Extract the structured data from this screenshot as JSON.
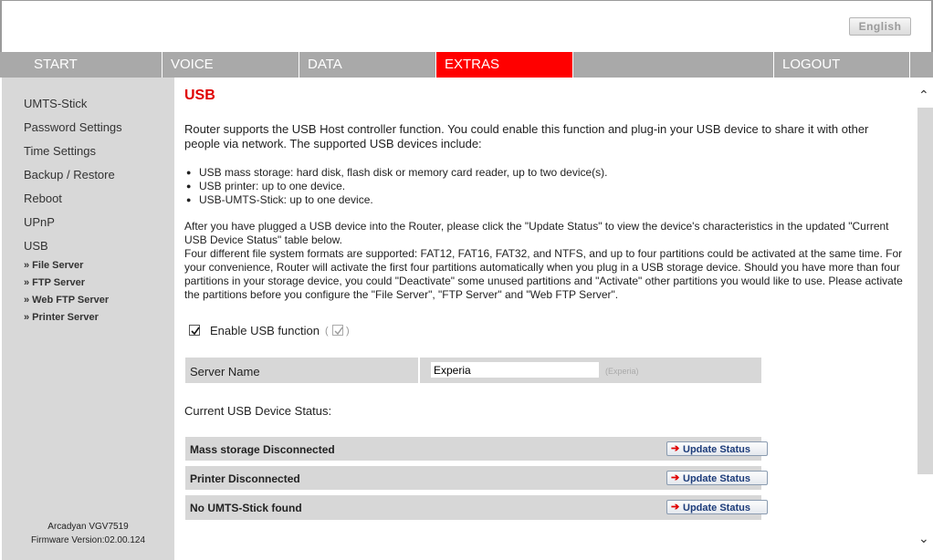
{
  "header": {
    "language_button": "English"
  },
  "nav": {
    "tabs": [
      {
        "label": "START"
      },
      {
        "label": "VOICE"
      },
      {
        "label": "DATA"
      },
      {
        "label": "EXTRAS"
      },
      {
        "label": ""
      },
      {
        "label": "LOGOUT"
      }
    ],
    "active_tab": "EXTRAS",
    "active_color": "#ff0000"
  },
  "sidebar": {
    "items": [
      {
        "label": "UMTS-Stick"
      },
      {
        "label": "Password Settings"
      },
      {
        "label": "Time Settings"
      },
      {
        "label": "Backup / Restore"
      },
      {
        "label": "Reboot"
      },
      {
        "label": "UPnP"
      },
      {
        "label": "USB"
      }
    ],
    "subitems": [
      {
        "label": "» File Server"
      },
      {
        "label": "» FTP Server"
      },
      {
        "label": "» Web FTP Server"
      },
      {
        "label": "» Printer Server"
      }
    ],
    "footer": {
      "model": "Arcadyan VGV7519",
      "firmware": "Firmware Version:02.00.124"
    }
  },
  "main": {
    "title": "USB",
    "intro": "Router supports the USB Host controller function. You could enable this function and plug-in your USB device to share it with other people via network. The supported USB devices include:",
    "bullets": [
      "USB mass storage: hard disk, flash disk or memory card reader, up to two device(s).",
      "USB printer: up to one device.",
      "USB-UMTS-Stick: up to one device."
    ],
    "details": "After you have plugged a USB device into the Router, please click the \"Update Status\" to view the device's characteristics in the updated \"Current USB Device Status\" table below.\nFour different file system formats are supported: FAT12, FAT16, FAT32, and NTFS, and up to four partitions could be activated at the same time. For your convenience, Router will activate the first four partitions automatically when you plug in a USB storage device. Should you have more than four partitions in your storage device, you could \"Deactivate\" some unused partitions and \"Activate\" other partitions you would like to use. Please activate the partitions before you configure the \"File Server\", \"FTP Server\" and \"Web FTP Server\".",
    "enable_usb": {
      "label": "Enable USB function",
      "checked": true,
      "default_checked": true
    },
    "server_name": {
      "label": "Server Name",
      "value": "Experia",
      "hint": "(Experia)"
    },
    "status_label": "Current USB Device Status:",
    "status_rows": [
      {
        "label": "Mass storage Disconnected",
        "button": "Update Status"
      },
      {
        "label": "Printer Disconnected",
        "button": "Update Status"
      },
      {
        "label": "No UMTS-Stick found",
        "button": "Update Status"
      }
    ]
  }
}
